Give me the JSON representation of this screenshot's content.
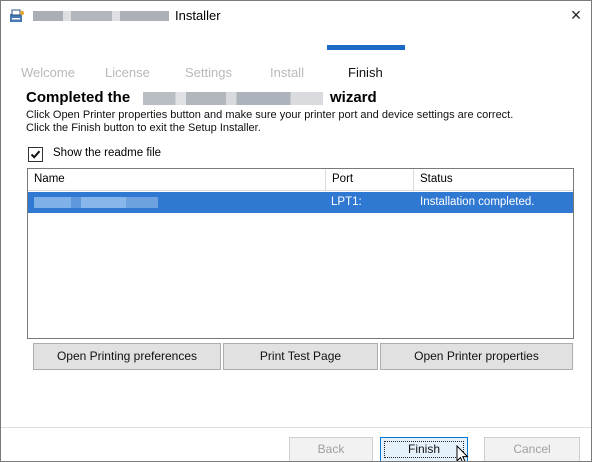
{
  "window": {
    "title_suffix": "Installer",
    "close_glyph": "×"
  },
  "steps": [
    {
      "label": "Welcome",
      "active": false
    },
    {
      "label": "License",
      "active": false
    },
    {
      "label": "Settings",
      "active": false
    },
    {
      "label": "Install",
      "active": false
    },
    {
      "label": "Finish",
      "active": true
    }
  ],
  "content": {
    "heading_part1": "Completed the",
    "heading_part2": "wizard",
    "description_line1": "Click Open Printer properties button and make sure your printer port and device settings are correct.",
    "description_line2": "Click the Finish button to exit the Setup Installer.",
    "readme_label": "Show the readme file",
    "readme_checked": true
  },
  "table": {
    "columns": [
      "Name",
      "Port",
      "Status"
    ],
    "rows": [
      {
        "name": "",
        "port": "LPT1:",
        "status": "Installation completed.",
        "selected": true
      }
    ]
  },
  "actions": {
    "open_printing_preferences": "Open Printing preferences",
    "print_test_page": "Print Test Page",
    "open_printer_properties": "Open Printer properties"
  },
  "footer": {
    "back": "Back",
    "finish": "Finish",
    "cancel": "Cancel"
  },
  "colors": {
    "accent": "#1c6ac7",
    "selection": "#3079d3",
    "disabled_text": "#a0a0a0"
  },
  "icons": {
    "app": "installer-app-icon",
    "close": "close-icon",
    "check": "checkmark-icon",
    "cursor": "mouse-pointer-icon"
  }
}
